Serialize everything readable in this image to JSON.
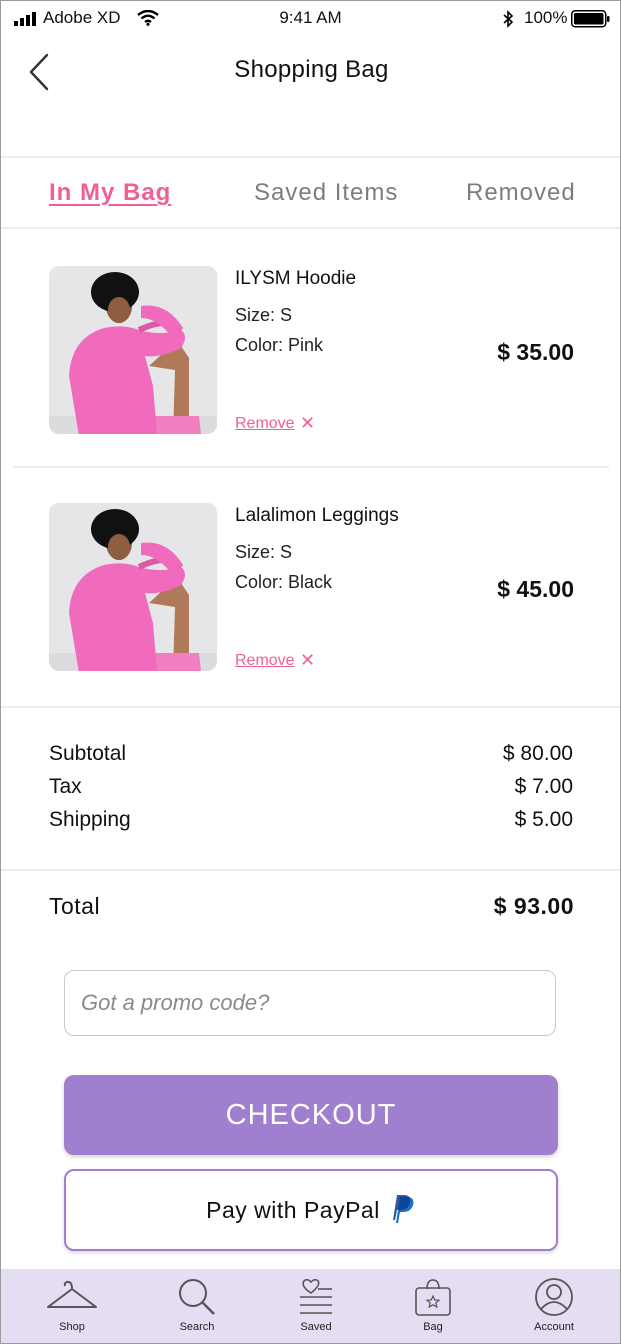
{
  "status_bar": {
    "carrier": "Adobe XD",
    "time": "9:41 AM",
    "battery": "100%"
  },
  "header": {
    "title": "Shopping Bag"
  },
  "tabs": [
    {
      "label": "In My Bag",
      "active": true
    },
    {
      "label": "Saved Items",
      "active": false
    },
    {
      "label": "Removed",
      "active": false
    }
  ],
  "items": [
    {
      "name": "ILYSM Hoodie",
      "size": "Size: S",
      "color": "Color: Pink",
      "price": "$ 35.00",
      "remove_label": "Remove"
    },
    {
      "name": "Lalalimon Leggings",
      "size": "Size: S",
      "color": "Color: Black",
      "price": "$ 45.00",
      "remove_label": "Remove"
    }
  ],
  "summary": {
    "subtotal_label": "Subtotal",
    "subtotal": "$ 80.00",
    "tax_label": "Tax",
    "tax": "$ 7.00",
    "shipping_label": "Shipping",
    "shipping": "$ 5.00",
    "total_label": "Total",
    "total": "$ 93.00"
  },
  "promo": {
    "placeholder": "Got a promo code?"
  },
  "buttons": {
    "checkout": "CHECKOUT",
    "paypal": "Pay with PayPal"
  },
  "nav": [
    {
      "label": "Shop",
      "icon": "hanger-icon"
    },
    {
      "label": "Search",
      "icon": "search-icon"
    },
    {
      "label": "Saved",
      "icon": "saved-list-icon"
    },
    {
      "label": "Bag",
      "icon": "bag-icon"
    },
    {
      "label": "Account",
      "icon": "account-icon"
    }
  ],
  "colors": {
    "accent_pink": "#f05f96",
    "accent_purple": "#a07fcf",
    "nav_bg": "#e5ddf2"
  }
}
